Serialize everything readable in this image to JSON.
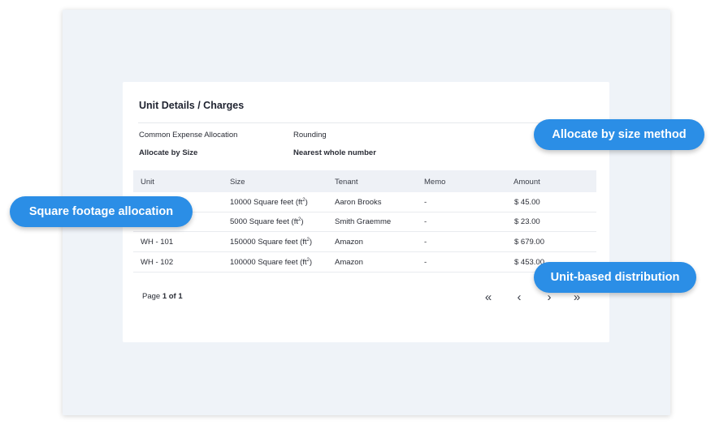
{
  "card": {
    "title": "Unit Details / Charges",
    "allocation_label": "Common Expense Allocation",
    "allocation_value": "Allocate by Size",
    "rounding_label": "Rounding",
    "rounding_value": "Nearest whole number"
  },
  "table": {
    "headers": [
      "Unit",
      "Size",
      "Tenant",
      "Memo",
      "Amount"
    ],
    "size_unit": "ft",
    "size_exp": "2",
    "rows": [
      {
        "unit": "",
        "size": "10000 Square feet (",
        "tenant": "Aaron Brooks",
        "memo": "-",
        "amount": "$ 45.00"
      },
      {
        "unit": "",
        "size": "5000 Square feet (",
        "tenant": "Smith Graemme",
        "memo": "-",
        "amount": "$ 23.00"
      },
      {
        "unit": "WH - 101",
        "size": "150000 Square feet (",
        "tenant": "Amazon",
        "memo": "-",
        "amount": "$ 679.00"
      },
      {
        "unit": "WH - 102",
        "size": "100000 Square feet (",
        "tenant": "Amazon",
        "memo": "-",
        "amount": "$ 453.00"
      }
    ]
  },
  "pagination": {
    "prefix": "Page",
    "current": "1 of 1",
    "first_icon": "«",
    "prev_icon": "‹",
    "next_icon": "›",
    "last_icon": "»"
  },
  "callouts": {
    "allocate_by_size": "Allocate by size method",
    "square_footage": "Square footage allocation",
    "unit_based": "Unit-based distribution"
  },
  "colors": {
    "accent": "#2b8ee6",
    "frame_bg": "#eff3f8",
    "table_header_bg": "#eef1f6"
  }
}
